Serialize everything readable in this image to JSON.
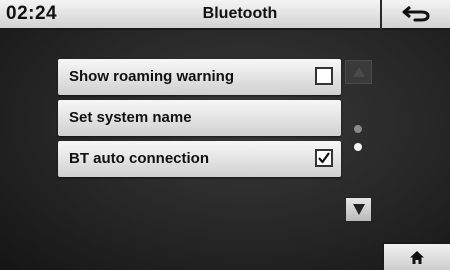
{
  "header": {
    "time": "02:24",
    "title": "Bluetooth",
    "back_icon": "back-arrow-icon"
  },
  "list": {
    "items": [
      {
        "label": "Show roaming warning",
        "has_checkbox": true,
        "checked": false
      },
      {
        "label": "Set system name",
        "has_checkbox": false
      },
      {
        "label": "BT auto connection",
        "has_checkbox": true,
        "checked": true
      }
    ]
  },
  "scroll": {
    "up_enabled": false,
    "down_enabled": true,
    "page_count": 2,
    "current_page": 2
  },
  "footer": {
    "home_icon": "home-icon"
  },
  "colors": {
    "background": "#262626",
    "header": "#e0e0e0",
    "row": "#e4e4e4",
    "text": "#111111"
  }
}
